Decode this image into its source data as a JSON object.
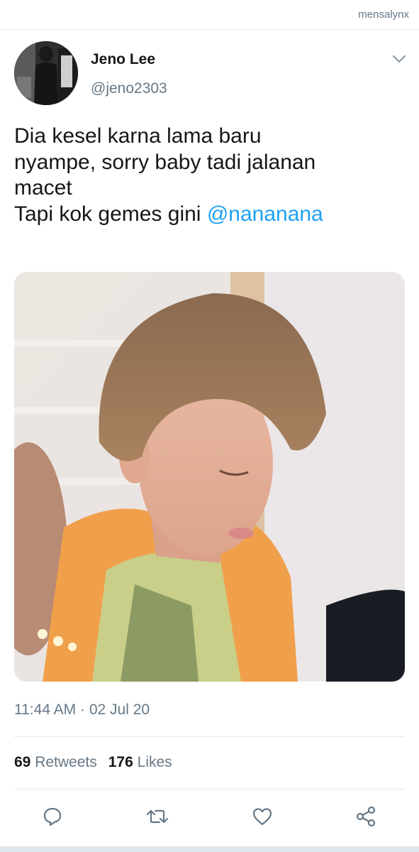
{
  "watermark": "mensalynx",
  "user": {
    "name": "Jeno Lee",
    "handle": "@jeno2303"
  },
  "tweet": {
    "lines": [
      "Dia kesel karna lama baru",
      "nyampe, sorry baby tadi jalanan",
      "macet",
      "Tapi kok gemes gini "
    ],
    "mention": "@nananana",
    "timestamp": "11:44 AM · 02 Jul 20"
  },
  "stats": {
    "retweets_count": "69",
    "retweets_label": "Retweets",
    "likes_count": "176",
    "likes_label": "Likes"
  },
  "icons": {
    "reply": "reply-icon",
    "retweet": "retweet-icon",
    "like": "heart-icon",
    "share": "share-icon",
    "menu": "chevron-down-icon"
  },
  "colors": {
    "link": "#1da1f2",
    "secondary_text": "#657786",
    "primary_text": "#14171a",
    "divider": "#e1e8ed"
  }
}
